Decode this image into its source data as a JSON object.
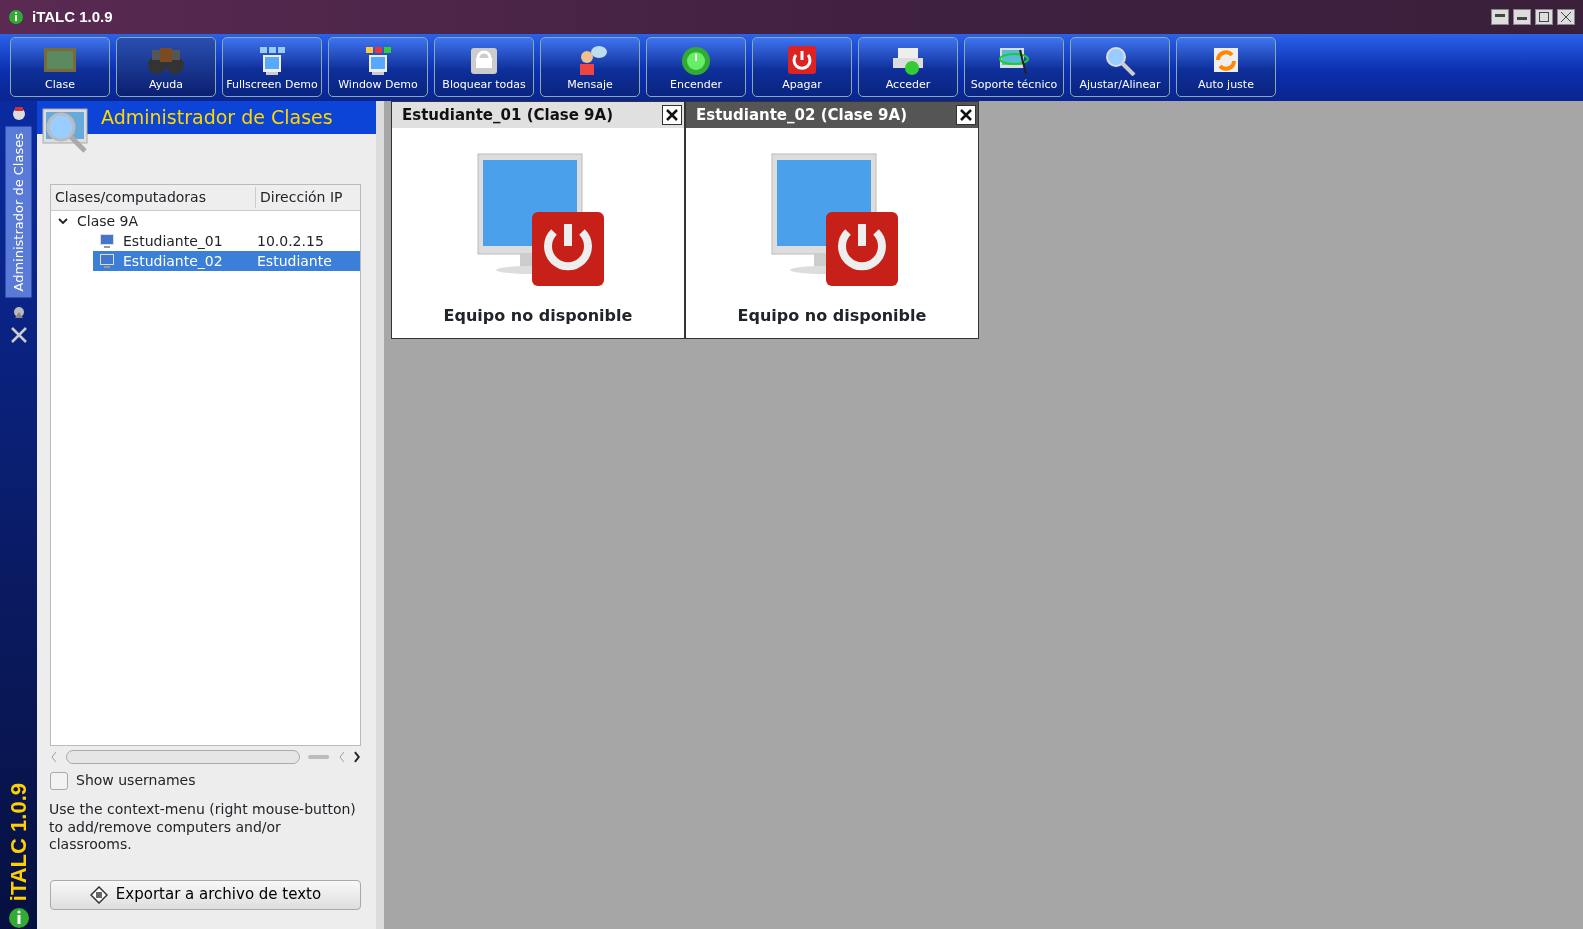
{
  "window": {
    "title": "iTALC 1.0.9"
  },
  "toolbar": [
    {
      "label": "Clase",
      "selected": false
    },
    {
      "label": "Ayuda",
      "selected": true
    },
    {
      "label": "Fullscreen Demo",
      "selected": false
    },
    {
      "label": "Window Demo",
      "selected": false
    },
    {
      "label": "Bloquear todas",
      "selected": false
    },
    {
      "label": "Mensaje",
      "selected": false
    },
    {
      "label": "Encender",
      "selected": false
    },
    {
      "label": "Apagar",
      "selected": false
    },
    {
      "label": "Acceder",
      "selected": false
    },
    {
      "label": "Soporte técnico",
      "selected": false
    },
    {
      "label": "Ajustar/Alinear",
      "selected": false
    },
    {
      "label": "Auto juste",
      "selected": false
    }
  ],
  "side_tabs": [
    {
      "label": "Administrador de Clases",
      "selected": true
    }
  ],
  "side_brand": "iTALC 1.0.9",
  "panel": {
    "title": "Administrador de Clases",
    "tree": {
      "columns": [
        "Clases/computadoras",
        "Dirección IP"
      ],
      "items": [
        {
          "name": "Clase 9A",
          "expanded": true,
          "selected": false,
          "children": [
            {
              "name": "Estudiante_01",
              "address": "10.0.2.15",
              "selected": false
            },
            {
              "name": "Estudiante_02",
              "address": "Estudiante",
              "selected": true
            }
          ]
        }
      ]
    },
    "show_usernames": {
      "label": "Show usernames",
      "checked": false
    },
    "hint": "Use the context-menu (right mouse-button) to add/remove computers and/or classrooms.",
    "export_button": "Exportar a archivo de texto"
  },
  "screens": [
    {
      "title": "Estudiante_01 (Clase 9A)",
      "status": "Equipo no disponible",
      "selected": false
    },
    {
      "title": "Estudiante_02 (Clase 9A)",
      "status": "Equipo no disponible",
      "selected": true
    }
  ]
}
